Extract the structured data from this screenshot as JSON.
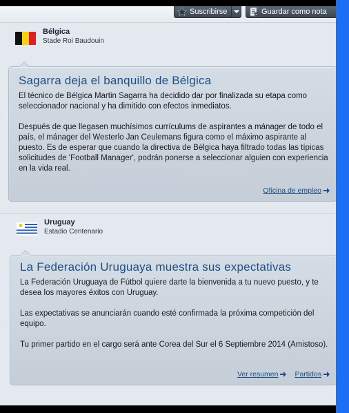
{
  "toolbar": {
    "subscribe_label": "Suscribirse",
    "save_label": "Guardar como nota"
  },
  "news": [
    {
      "team": "Bélgica",
      "stadium": "Stade Roi Baudouin",
      "headline": "Sagarra deja el banquillo de Bélgica",
      "paragraphs": [
        "El técnico de Bélgica Martin Sagarra ha decidido dar por finalizada su etapa como seleccionador nacional y ha dimitido con efectos inmediatos.",
        "Después de que llegasen muchísimos currículums de aspirantes a mánager de todo el país, el mánager del Westerlo Jan Ceulemans figura como el máximo aspirante al puesto. Es de esperar que cuando la directiva de Bélgica haya filtrado todas las típicas solicitudes de 'Football Manager', podrán ponerse a seleccionar alguien con experiencia en la vida real."
      ],
      "links": [
        "Oficina de empleo"
      ]
    },
    {
      "team": "Uruguay",
      "stadium": "Estadio Centenario",
      "headline": "La Federación Uruguaya muestra sus expectativas",
      "paragraphs": [
        "La Federación Uruguaya de Fútbol quiere darte la bienvenida a tu nuevo puesto, y te desea los mayores éxitos con Uruguay.",
        "Las expectativas se anunciarán cuando esté confirmada la próxima competición del equipo.",
        "Tu primer partido en el cargo será ante Corea del Sur el 6 Septiembre 2014 (Amistoso)."
      ],
      "links": [
        "Ver resumen",
        "Partidos"
      ]
    }
  ],
  "colors": {
    "accent_blue": "#1a6ff5",
    "headline": "#1e4f82",
    "panel": "#e3e9ef"
  },
  "icons": [
    "star-icon",
    "chevron-down-icon",
    "note-icon",
    "belgium-flag",
    "uruguay-flag",
    "arrow-right-icon"
  ]
}
